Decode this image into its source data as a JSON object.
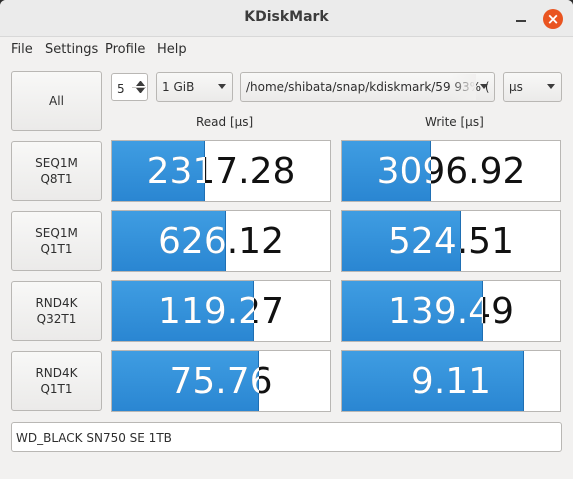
{
  "window": {
    "title": "KDiskMark"
  },
  "menu": [
    "File",
    "Settings",
    "Profile",
    "Help"
  ],
  "controls": {
    "all_button": "All",
    "runs": "5",
    "size": "1 GiB",
    "path": "/home/shibata/snap/kdiskmark/59 93% (",
    "unit": "µs"
  },
  "columns": {
    "read": "Read [µs]",
    "write": "Write [µs]"
  },
  "tests": [
    {
      "line1": "SEQ1M",
      "line2": "Q8T1",
      "read": "2317.28",
      "write": "3096.92",
      "read_fill": 0.425,
      "write_fill": 0.41
    },
    {
      "line1": "SEQ1M",
      "line2": "Q1T1",
      "read": "626.12",
      "write": "524.51",
      "read_fill": 0.525,
      "write_fill": 0.545
    },
    {
      "line1": "RND4K",
      "line2": "Q32T1",
      "read": "119.27",
      "write": "139.49",
      "read_fill": 0.65,
      "write_fill": 0.645
    },
    {
      "line1": "RND4K",
      "line2": "Q1T1",
      "read": "75.76",
      "write": "9.11",
      "read_fill": 0.675,
      "write_fill": 0.835
    }
  ],
  "status": "WD_BLACK SN750 SE 1TB",
  "colors": {
    "bar": "#2a86d2",
    "close": "#e95420"
  },
  "icons": [
    "minimize-icon",
    "close-icon",
    "spin-up-icon",
    "spin-down-icon",
    "chevron-down-icon"
  ]
}
